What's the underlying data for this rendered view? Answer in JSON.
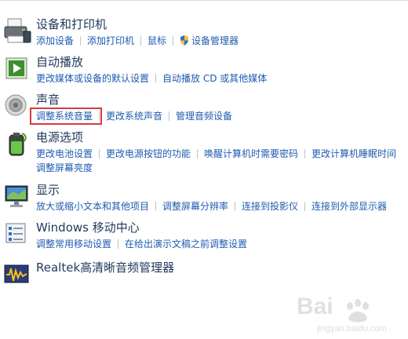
{
  "categories": [
    {
      "id": "devices",
      "title": "设备和打印机",
      "links": [
        "添加设备",
        "添加打印机",
        "鼠标",
        "设备管理器"
      ]
    },
    {
      "id": "autoplay",
      "title": "自动播放",
      "links": [
        "更改媒体或设备的默认设置",
        "自动播放 CD 或其他媒体"
      ]
    },
    {
      "id": "sound",
      "title": "声音",
      "links": [
        "调整系统音量",
        "更改系统声音",
        "管理音频设备"
      ]
    },
    {
      "id": "power",
      "title": "电源选项",
      "links": [
        "更改电池设置",
        "更改电源按钮的功能",
        "唤醒计算机时需要密码",
        "更改计算机睡眠时间",
        "调整屏幕亮度"
      ]
    },
    {
      "id": "display",
      "title": "显示",
      "links": [
        "放大或缩小文本和其他项目",
        "调整屏幕分辨率",
        "连接到投影仪",
        "连接到外部显示器"
      ]
    },
    {
      "id": "mobility",
      "title": "Windows 移动中心",
      "links": [
        "调整常用移动设置",
        "在给出演示文稿之前调整设置"
      ]
    },
    {
      "id": "realtek",
      "title": "Realtek高清晰音频管理器",
      "links": []
    }
  ],
  "watermark": {
    "text": "Bai",
    "sub": "jingyan.baidu.com"
  },
  "colors": {
    "link": "#1e5bb0",
    "title": "#1e395b",
    "highlight": "#d93a3a"
  }
}
